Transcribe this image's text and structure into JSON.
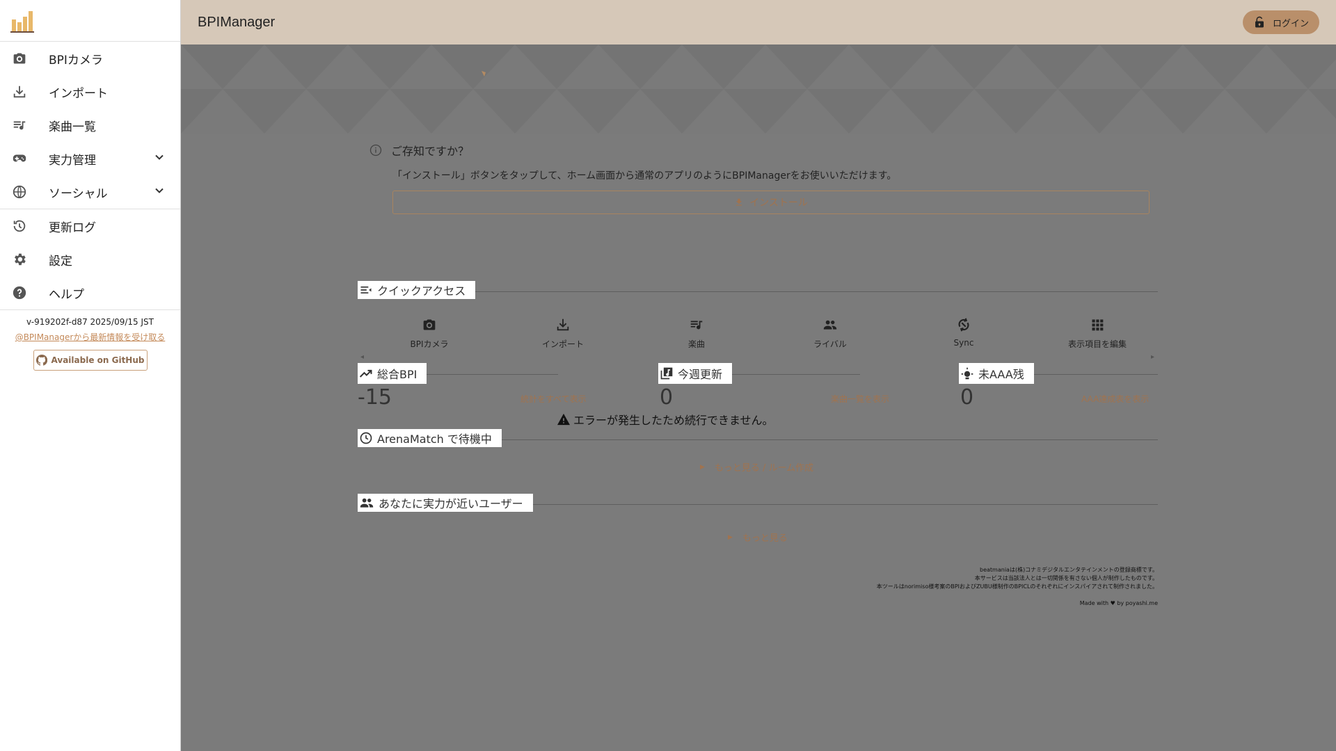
{
  "app": {
    "title": "BPIManager"
  },
  "header": {
    "login_label": "ログイン"
  },
  "sidebar": {
    "items": [
      {
        "label": "BPIカメラ",
        "icon": "camera-icon"
      },
      {
        "label": "インポート",
        "icon": "download-icon"
      },
      {
        "label": "楽曲一覧",
        "icon": "playlist-icon"
      },
      {
        "label": "実力管理",
        "icon": "gamepad-icon"
      },
      {
        "label": "ソーシャル",
        "icon": "globe-icon"
      },
      {
        "label": "更新ログ",
        "icon": "history-icon"
      },
      {
        "label": "設定",
        "icon": "gear-icon"
      },
      {
        "label": "ヘルプ",
        "icon": "help-icon"
      }
    ],
    "version": "v-919202f-d87 2025/09/15 JST",
    "twitter_link": "@BPIManagerから最新情報を受け取る",
    "github_label": "Available on GitHub"
  },
  "info": {
    "title": "ご存知ですか？",
    "body": "「インストール」ボタンをタップして、ホーム画面から通常のアプリのようにBPIManagerをお使いいただけます。",
    "install_label": "インストール"
  },
  "quick_access": {
    "title": "クイックアクセス",
    "items": [
      {
        "label": "BPIカメラ",
        "icon": "camera-icon"
      },
      {
        "label": "インポート",
        "icon": "download-icon"
      },
      {
        "label": "楽曲",
        "icon": "playlist-icon"
      },
      {
        "label": "ライバル",
        "icon": "people-icon"
      },
      {
        "label": "Sync",
        "icon": "sync-icon"
      },
      {
        "label": "表示項目を編集",
        "icon": "grid-icon"
      }
    ]
  },
  "stats": {
    "total_bpi": {
      "title": "総合BPI",
      "value": "-15",
      "link": "統計をすべて表示"
    },
    "weekly": {
      "title": "今週更新",
      "value": "0",
      "link": "楽曲一覧を表示"
    },
    "aaa": {
      "title": "未AAA残",
      "value": "0",
      "link": "AAA達成表を表示"
    }
  },
  "error": {
    "message": "エラーが発生したため続行できません。"
  },
  "arena": {
    "title": "ArenaMatch で待機中",
    "more": "もっと見る / ルーム作成"
  },
  "similar": {
    "title": "あなたに実力が近いユーザー",
    "more": "もっと見る"
  },
  "footer": {
    "line1": "beatmaniaは(株)コナミデジタルエンタテインメントの登録商標です。",
    "line2": "本サービスは当該法人とは一切関係を有さない個人が制作したものです。",
    "line3": "本ツールはnorimiso様考案のBPIおよびZUBU様制作のBPICLのそれぞれにインスパイアされて制作されました。",
    "credit": "Made with ♥ by poyashi.me"
  },
  "colors": {
    "header_bg": "#d6c8b8",
    "accent": "#a0734f",
    "main_bg": "#7b7b7b",
    "login_bg": "#b98f6a"
  }
}
